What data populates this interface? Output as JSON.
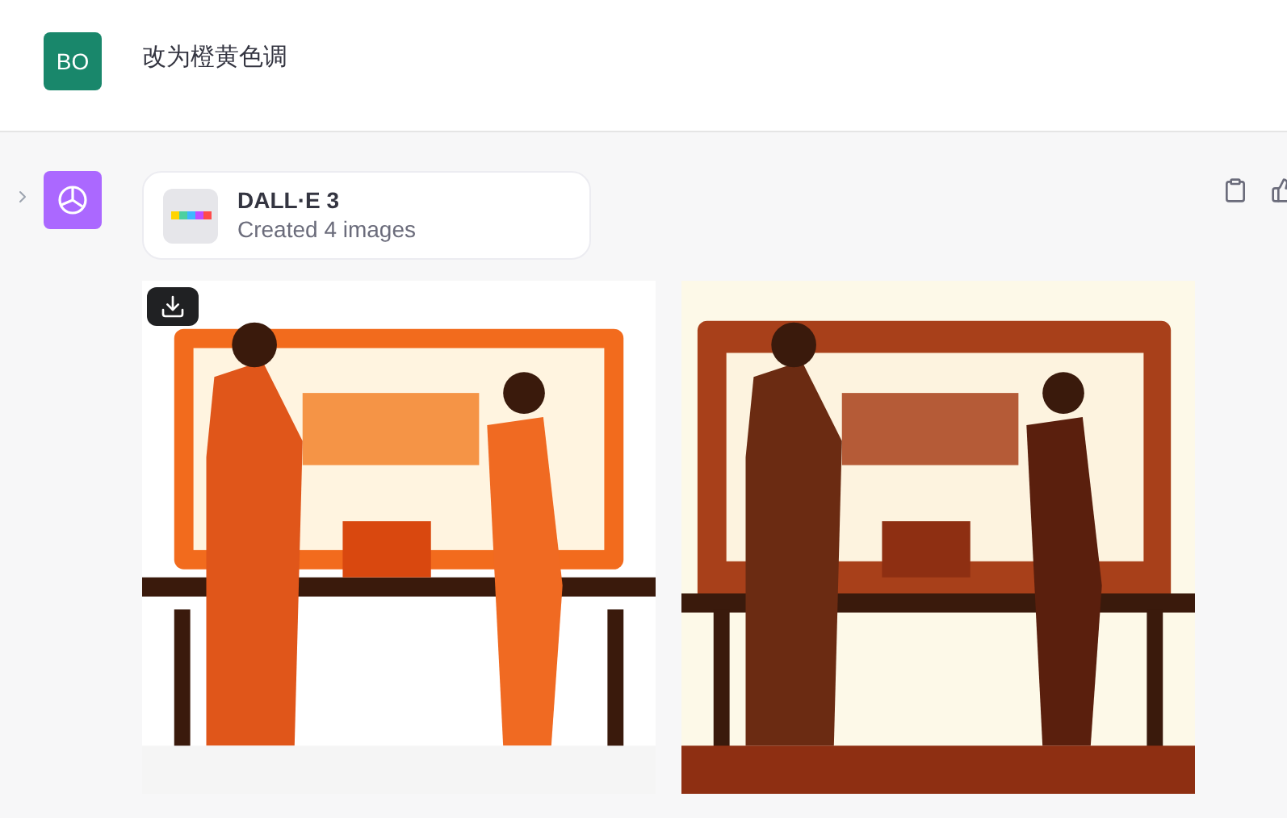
{
  "user_message": {
    "avatar": "BO",
    "text": "改为橙黄色调"
  },
  "assistant_message": {
    "tool": {
      "name": "DALL·E 3",
      "status": "Created 4 images"
    },
    "images": [
      {
        "kind": "picture",
        "download_button": true
      },
      {
        "kind": "picture",
        "download_button": false
      }
    ]
  }
}
